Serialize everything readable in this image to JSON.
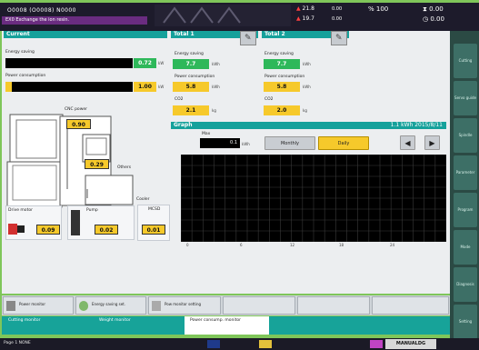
{
  "topbar": {
    "program_line": "O0008 (O0008)  N0000",
    "alarm_message": "EX0 Exchange the ion resin.",
    "stat_a": "21.8",
    "stat_b": "19.7",
    "stat_c": "0.00",
    "stat_d": "0.00",
    "stat_e": "100",
    "stat_f": "0.00",
    "stat_g": "0.00"
  },
  "current": {
    "header": "Current",
    "energy_saving_label": "Energy saving",
    "energy_saving_value": "0.72",
    "energy_saving_unit": "kW",
    "power_consumption_label": "Power consumption",
    "power_consumption_value": "1.00",
    "power_consumption_unit": "kW",
    "cnc_power_label": "CNC power",
    "cnc_power_value": "0.90",
    "others_label": "Others",
    "others_value": "0.29",
    "drive_motor_label": "Drive motor",
    "drive_motor_value": "0.09",
    "pump_label": "Pump",
    "pump_value": "0.02",
    "cooler_label": "Cooler",
    "cooler_sub": "MCSD",
    "cooler_value": "0.01"
  },
  "total1": {
    "header": "Total 1",
    "energy_saving_label": "Energy saving",
    "energy_saving_value": "7.7",
    "power_consumption_label": "Power consumption",
    "power_consumption_value": "5.8",
    "co2_label": "CO2",
    "co2_value": "2.1",
    "unit_kwh": "kWh",
    "unit_kg": "kg"
  },
  "total2": {
    "header": "Total 2",
    "energy_saving_label": "Energy saving",
    "energy_saving_value": "7.7",
    "power_consumption_label": "Power consumption",
    "power_consumption_value": "5.8",
    "co2_label": "CO2",
    "co2_value": "2.0",
    "unit_kwh": "kWh",
    "unit_kg": "kg"
  },
  "graph": {
    "header": "Graph",
    "header_right": "1.1 kWh   2015/8/11",
    "max_label": "Max",
    "max_value": "0.1",
    "max_unit": "kWh",
    "monthly_label": "Monthly",
    "daily_label": "Daily",
    "x_ticks": [
      "0",
      "6",
      "12",
      "18",
      "24"
    ]
  },
  "chart_data": {
    "type": "bar",
    "categories": [],
    "values": [],
    "xlabel": "",
    "ylabel": ""
  },
  "tabs_row1": [
    {
      "label": "Power monitor"
    },
    {
      "label": "Energy saving set."
    },
    {
      "label": "Pow monitor setting"
    }
  ],
  "tabs_row2": [
    {
      "label": "Cutting monitor"
    },
    {
      "label": "Weight monitor"
    },
    {
      "label": "Power consump. monitor"
    }
  ],
  "softkeys": [
    "Cutting",
    "Servo guide",
    "Spindle",
    "Parameter",
    "Program",
    "Mode",
    "Diagnosis",
    "Setting"
  ],
  "statusbar": {
    "left": "Page 1  NONE",
    "right": "MANUALDG"
  },
  "colors": {
    "teal": "#15a19b",
    "yellow": "#f6c92b",
    "green": "#2eb85a",
    "dark": "#1d1b2b"
  }
}
